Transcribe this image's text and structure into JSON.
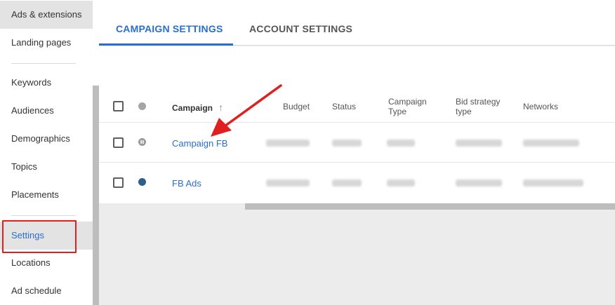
{
  "sidebar": {
    "items": [
      {
        "label": "Ads & extensions"
      },
      {
        "label": "Landing pages"
      },
      {
        "label": "Keywords"
      },
      {
        "label": "Audiences"
      },
      {
        "label": "Demographics"
      },
      {
        "label": "Topics"
      },
      {
        "label": "Placements"
      },
      {
        "label": "Settings"
      },
      {
        "label": "Locations"
      },
      {
        "label": "Ad schedule"
      }
    ]
  },
  "tabs": {
    "campaign_settings": "CAMPAIGN SETTINGS",
    "account_settings": "ACCOUNT SETTINGS"
  },
  "table": {
    "headers": {
      "campaign": "Campaign",
      "sort_arrow": "↑",
      "budget": "Budget",
      "status": "Status",
      "campaign_type": "Campaign\nType",
      "bid_strategy": "Bid strategy\ntype",
      "networks": "Networks"
    },
    "rows": [
      {
        "name": "Campaign FB",
        "status_icon": "pause-icon"
      },
      {
        "name": "FB Ads",
        "status_icon": "enabled-dot-icon"
      }
    ]
  },
  "colors": {
    "accent": "#2a6ec9",
    "highlight": "#e02020",
    "enabled_dot": "#2f5f8f"
  }
}
